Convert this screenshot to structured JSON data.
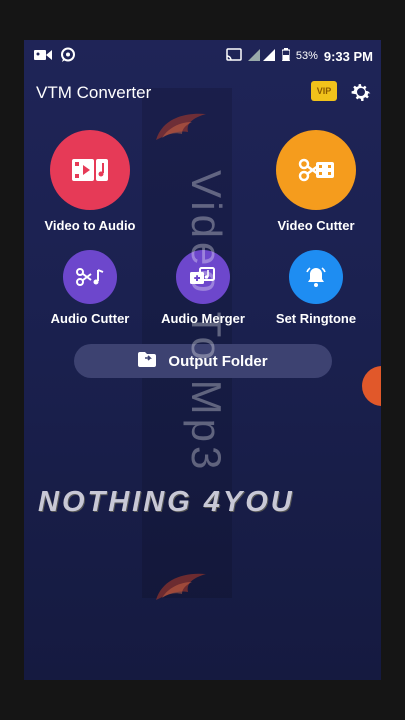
{
  "status_bar": {
    "battery": "53%",
    "time": "9:33 PM"
  },
  "app": {
    "title": "VTM Converter",
    "vip_badge": "VIP"
  },
  "buttons": {
    "video_to_audio": "Video to Audio",
    "video_cutter": "Video Cutter",
    "audio_cutter": "Audio Cutter",
    "audio_merger": "Audio Merger",
    "set_ringtone": "Set Ringtone",
    "output_folder": "Output Folder"
  },
  "overlay": {
    "vertical_text": "Video To Mp3",
    "watermark": "NOTHING 4YOU"
  },
  "colors": {
    "video_to_audio": "#e63a57",
    "video_cutter": "#f59c1d",
    "audio_cutter": "#6d47cc",
    "audio_merger": "#6d47cc",
    "set_ringtone": "#1e8df2"
  },
  "icons": [
    "video-camera-icon",
    "whatsapp-icon",
    "cast-icon",
    "signal-icon",
    "battery-icon",
    "vip-icon",
    "gear-icon",
    "film-music-icon",
    "scissors-film-icon",
    "scissors-music-icon",
    "merge-music-icon",
    "bell-icon",
    "folder-icon"
  ]
}
